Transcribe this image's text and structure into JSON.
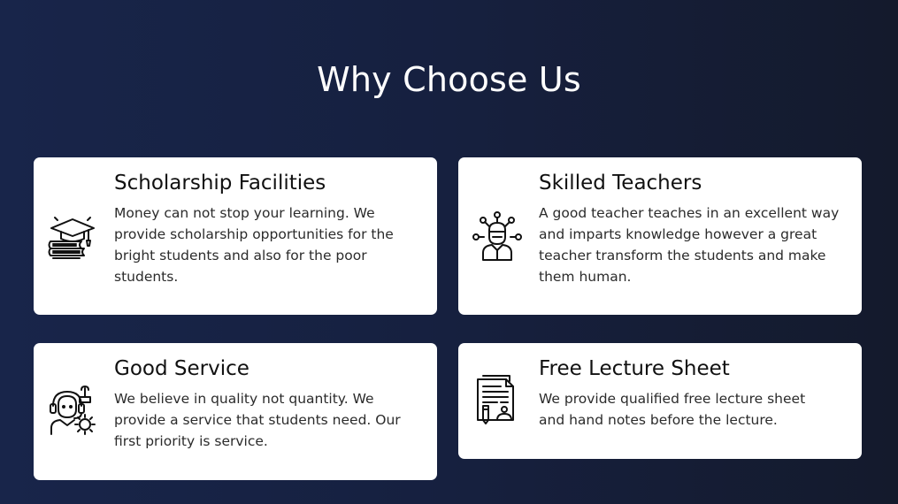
{
  "section": {
    "title": "Why Choose Us"
  },
  "cards": [
    {
      "icon": "graduation-books-icon",
      "title": "Scholarship Facilities",
      "text": "Money can not stop your learning. We provide scholarship opportunities for the bright students and also for the poor students."
    },
    {
      "icon": "teacher-network-icon",
      "title": "Skilled Teachers",
      "text": "A good teacher teaches in an excellent way and imparts knowledge however a great teacher transform the students and make them human."
    },
    {
      "icon": "support-agent-gear-icon",
      "title": "Good Service",
      "text": "We believe in quality not quantity. We provide a service that students need. Our first priority is service."
    },
    {
      "icon": "lecture-sheet-icon",
      "title": "Free Lecture Sheet",
      "text": "We provide qualified free lecture sheet and hand notes before the lecture."
    }
  ],
  "colors": {
    "background_left": "#18254a",
    "background_right": "#141a2c",
    "card": "#ffffff",
    "title_text": "#ffffff",
    "card_title": "#111111",
    "card_text": "#2b2b2b"
  }
}
